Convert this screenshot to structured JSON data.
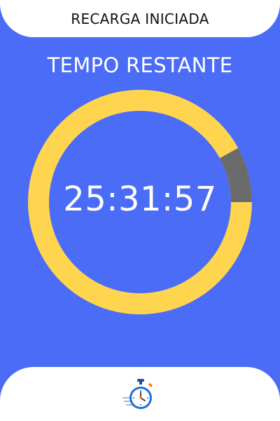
{
  "header": {
    "title": "RECARGA INICIADA"
  },
  "main": {
    "section_title": "TEMPO RESTANTE",
    "timer": {
      "value": "25:31:57",
      "progress_elapsed_percent": 8
    }
  },
  "footer": {
    "icon": "stopwatch-icon"
  },
  "colors": {
    "background": "#4A6CF7",
    "ring_remaining": "#FFD54F",
    "ring_elapsed": "#6B6B6B",
    "pill_background": "#FFFFFF",
    "header_text": "#111111",
    "main_text": "#FFFFFF"
  }
}
